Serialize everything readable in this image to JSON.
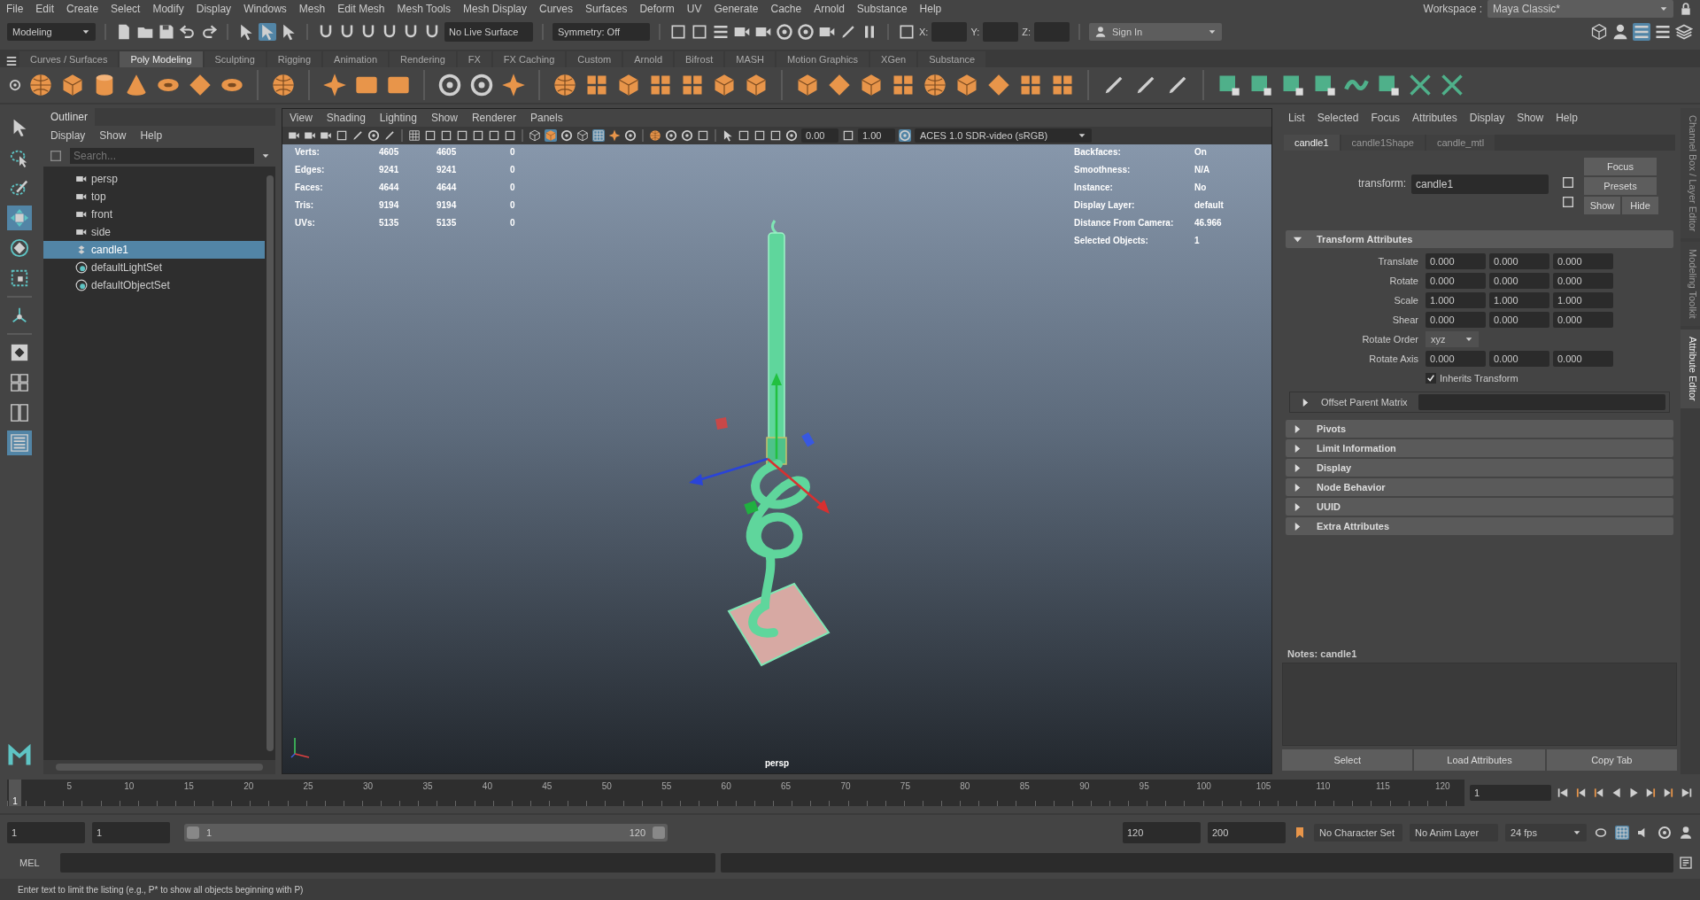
{
  "menu_bar": [
    "File",
    "Edit",
    "Create",
    "Select",
    "Modify",
    "Display",
    "Windows",
    "Mesh",
    "Edit Mesh",
    "Mesh Tools",
    "Mesh Display",
    "Curves",
    "Surfaces",
    "Deform",
    "UV",
    "Generate",
    "Cache",
    "Arnold",
    "Substance",
    "Help"
  ],
  "workspace": {
    "label": "Workspace :",
    "value": "Maya Classic*"
  },
  "status_line": {
    "mode": "Modeling",
    "live_surface": "No Live Surface",
    "symmetry": "Symmetry: Off",
    "coord_labels": [
      "X:",
      "Y:",
      "Z:"
    ],
    "sign_in": "Sign In"
  },
  "shelf_tabs": [
    {
      "label": "Curves / Surfaces",
      "selected": false
    },
    {
      "label": "Poly Modeling",
      "selected": true
    },
    {
      "label": "Sculpting",
      "selected": false
    },
    {
      "label": "Rigging",
      "selected": false
    },
    {
      "label": "Animation",
      "selected": false
    },
    {
      "label": "Rendering",
      "selected": false
    },
    {
      "label": "FX",
      "selected": false
    },
    {
      "label": "FX Caching",
      "selected": false
    },
    {
      "label": "Custom",
      "selected": false
    },
    {
      "label": "Arnold",
      "selected": false
    },
    {
      "label": "Bifrost",
      "selected": false
    },
    {
      "label": "MASH",
      "selected": false
    },
    {
      "label": "Motion Graphics",
      "selected": false
    },
    {
      "label": "XGen",
      "selected": false
    },
    {
      "label": "Substance",
      "selected": false
    }
  ],
  "toolbox": [
    {
      "kind": "select",
      "selected": false
    },
    {
      "kind": "lasso",
      "selected": false
    },
    {
      "kind": "paint",
      "selected": false
    },
    {
      "kind": "move",
      "selected": true
    },
    {
      "kind": "rotate",
      "selected": false
    },
    {
      "kind": "scale",
      "selected": false
    },
    {
      "kind": "soft",
      "selected": false
    },
    {
      "kind": "layout-single",
      "selected": false
    },
    {
      "kind": "layout-quad",
      "selected": false
    },
    {
      "kind": "layout-split",
      "selected": false
    },
    {
      "kind": "layout-outliner",
      "selected": true
    }
  ],
  "outliner": {
    "title": "Outliner",
    "menu": [
      "Display",
      "Show",
      "Help"
    ],
    "search_placeholder": "Search...",
    "items": [
      {
        "label": "persp",
        "kind": "camera",
        "selected": false
      },
      {
        "label": "top",
        "kind": "camera",
        "selected": false
      },
      {
        "label": "front",
        "kind": "camera",
        "selected": false
      },
      {
        "label": "side",
        "kind": "camera",
        "selected": false
      },
      {
        "label": "candle1",
        "kind": "transform",
        "selected": true
      },
      {
        "label": "defaultLightSet",
        "kind": "set",
        "selected": false
      },
      {
        "label": "defaultObjectSet",
        "kind": "set",
        "selected": false
      }
    ]
  },
  "viewport": {
    "menu": [
      "View",
      "Shading",
      "Lighting",
      "Show",
      "Renderer",
      "Panels"
    ],
    "exposure": "0.00",
    "gamma": "1.00",
    "color_space": "ACES 1.0 SDR-video (sRGB)",
    "stats": [
      {
        "label": "Verts:",
        "values": [
          "4605",
          "4605",
          "0"
        ]
      },
      {
        "label": "Edges:",
        "values": [
          "9241",
          "9241",
          "0"
        ]
      },
      {
        "label": "Faces:",
        "values": [
          "4644",
          "4644",
          "0"
        ]
      },
      {
        "label": "Tris:",
        "values": [
          "9194",
          "9194",
          "0"
        ]
      },
      {
        "label": "UVs:",
        "values": [
          "5135",
          "5135",
          "0"
        ]
      }
    ],
    "info": [
      {
        "label": "Backfaces:",
        "value": "On"
      },
      {
        "label": "Smoothness:",
        "value": "N/A"
      },
      {
        "label": "Instance:",
        "value": "No"
      },
      {
        "label": "Display Layer:",
        "value": "default"
      },
      {
        "label": "Distance From Camera:",
        "value": "46.966"
      },
      {
        "label": "Selected Objects:",
        "value": "1"
      }
    ],
    "camera": "persp"
  },
  "attribute_editor": {
    "menu": [
      "List",
      "Selected",
      "Focus",
      "Attributes",
      "Display",
      "Show",
      "Help"
    ],
    "tabs": [
      {
        "label": "candle1",
        "selected": true
      },
      {
        "label": "candle1Shape",
        "selected": false
      },
      {
        "label": "candle_mtl",
        "selected": false
      }
    ],
    "node_label": "transform:",
    "node_value": "candle1",
    "buttons": [
      "Focus",
      "Presets",
      "Show",
      "Hide"
    ],
    "sections": [
      {
        "label": "Transform Attributes",
        "kind": "transform",
        "expanded": true
      },
      {
        "label": "Pivots",
        "kind": "plain",
        "expanded": false
      },
      {
        "label": "Limit Information",
        "kind": "plain",
        "expanded": false
      },
      {
        "label": "Display",
        "kind": "plain",
        "expanded": false
      },
      {
        "label": "Node Behavior",
        "kind": "plain",
        "expanded": false
      },
      {
        "label": "UUID",
        "kind": "plain",
        "expanded": false
      },
      {
        "label": "Extra Attributes",
        "kind": "plain",
        "expanded": false
      }
    ],
    "transform_rows": [
      {
        "label": "Translate",
        "values": [
          "0.000",
          "0.000",
          "0.000"
        ]
      },
      {
        "label": "Rotate",
        "values": [
          "0.000",
          "0.000",
          "0.000"
        ]
      },
      {
        "label": "Scale",
        "values": [
          "1.000",
          "1.000",
          "1.000"
        ]
      },
      {
        "label": "Shear",
        "values": [
          "0.000",
          "0.000",
          "0.000"
        ]
      }
    ],
    "rotate_order": {
      "label": "Rotate Order",
      "value": "xyz"
    },
    "rotate_axis": {
      "label": "Rotate Axis",
      "values": [
        "0.000",
        "0.000",
        "0.000"
      ]
    },
    "inherits": {
      "label": "Inherits Transform",
      "checked": true
    },
    "offset_parent": {
      "label": "Offset Parent Matrix",
      "expanded": false
    },
    "notes_label": "Notes:  candle1",
    "bottom_buttons": [
      "Select",
      "Load Attributes",
      "Copy Tab"
    ]
  },
  "side_tabs": [
    {
      "label": "Channel Box / Layer Editor",
      "selected": false
    },
    {
      "label": "Modeling Toolkit",
      "selected": false
    },
    {
      "label": "Attribute Editor",
      "selected": true
    }
  ],
  "timeline": {
    "current": "1",
    "level": 0,
    "ticks": [
      "5",
      "10",
      "15",
      "20",
      "25",
      "30",
      "35",
      "40",
      "45",
      "50",
      "55",
      "60",
      "65",
      "70",
      "75",
      "80",
      "85",
      "90",
      "95",
      "100",
      "105",
      "110",
      "115",
      "120"
    ],
    "frame_field": "1"
  },
  "range": {
    "level": 1,
    "start": "1",
    "playback_start": "1",
    "slider_start": "1",
    "slider_end": "120",
    "playback_end": "120",
    "end": "200",
    "character_set": "No Character Set",
    "anim_layer": "No Anim Layer",
    "fps": "24 fps"
  },
  "command_line": {
    "language": "MEL"
  },
  "help_line": "Enter text to limit the listing (e.g., P* to show all objects beginning with P)"
}
